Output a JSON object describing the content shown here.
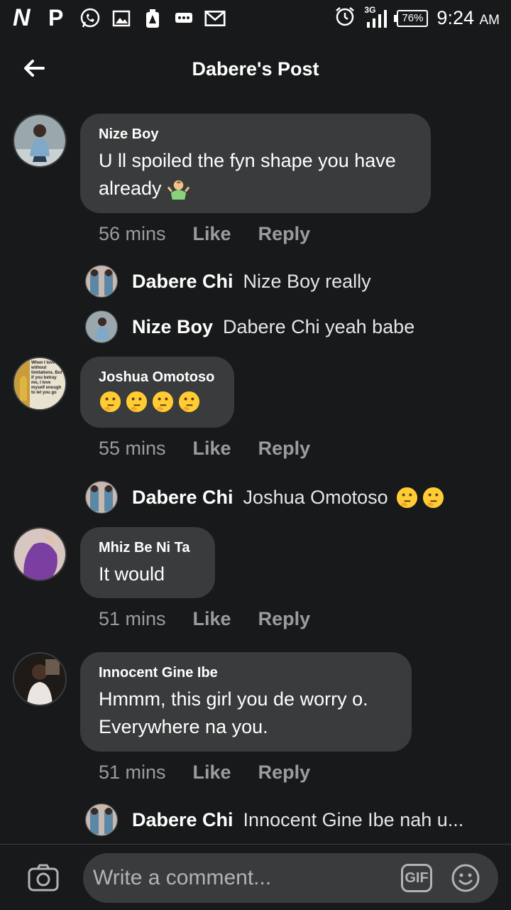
{
  "status_bar": {
    "left_icons": [
      "n-app-icon",
      "p-app-icon",
      "whatsapp-icon",
      "gallery-icon",
      "alert-icon",
      "message-icon",
      "gmail-icon"
    ],
    "n_label": "N",
    "p_label": "P",
    "network": "3G",
    "battery": "76%",
    "time": "9:24",
    "ampm": "AM"
  },
  "header": {
    "title": "Dabere's Post"
  },
  "comments": [
    {
      "author": "Nize Boy",
      "text": "U ll spoiled the fyn shape you have already",
      "trailing_emoji": "person-shrugging",
      "time": "56 mins",
      "like": "Like",
      "reply": "Reply",
      "replies": [
        {
          "author": "Dabere Chi",
          "text": "Nize Boy really"
        },
        {
          "author": "Nize Boy",
          "text": "Dabere Chi yeah babe"
        }
      ]
    },
    {
      "author": "Joshua Omotoso",
      "emojis": [
        "thinking-face",
        "thinking-face",
        "thinking-face",
        "thinking-face"
      ],
      "time": "55 mins",
      "like": "Like",
      "reply": "Reply",
      "replies": [
        {
          "author": "Dabere Chi",
          "text": "Joshua Omotoso",
          "emojis": [
            "thinking-face",
            "thinking-face"
          ]
        }
      ],
      "avatar_caption": "When I love without limitations. But if you betray me, I love myself enough to let you go"
    },
    {
      "author": "Mhiz Be Ni Ta",
      "text": "It would",
      "time": "51 mins",
      "like": "Like",
      "reply": "Reply"
    },
    {
      "author": "Innocent Gine Ibe",
      "text_line1": "Hmmm, this girl you de worry o.",
      "text_line2": "Everywhere na you.",
      "time": "51 mins",
      "like": "Like",
      "reply": "Reply",
      "replies": [
        {
          "author": "Dabere Chi",
          "text": "Innocent Gine Ibe nah u..."
        }
      ]
    }
  ],
  "composer": {
    "placeholder": "Write a comment...",
    "gif_label": "GIF"
  },
  "colors": {
    "background": "#18191a",
    "bubble": "#3a3b3c",
    "meta_text": "#9a9ca0",
    "emoji_yellow": "#ffcc33"
  }
}
